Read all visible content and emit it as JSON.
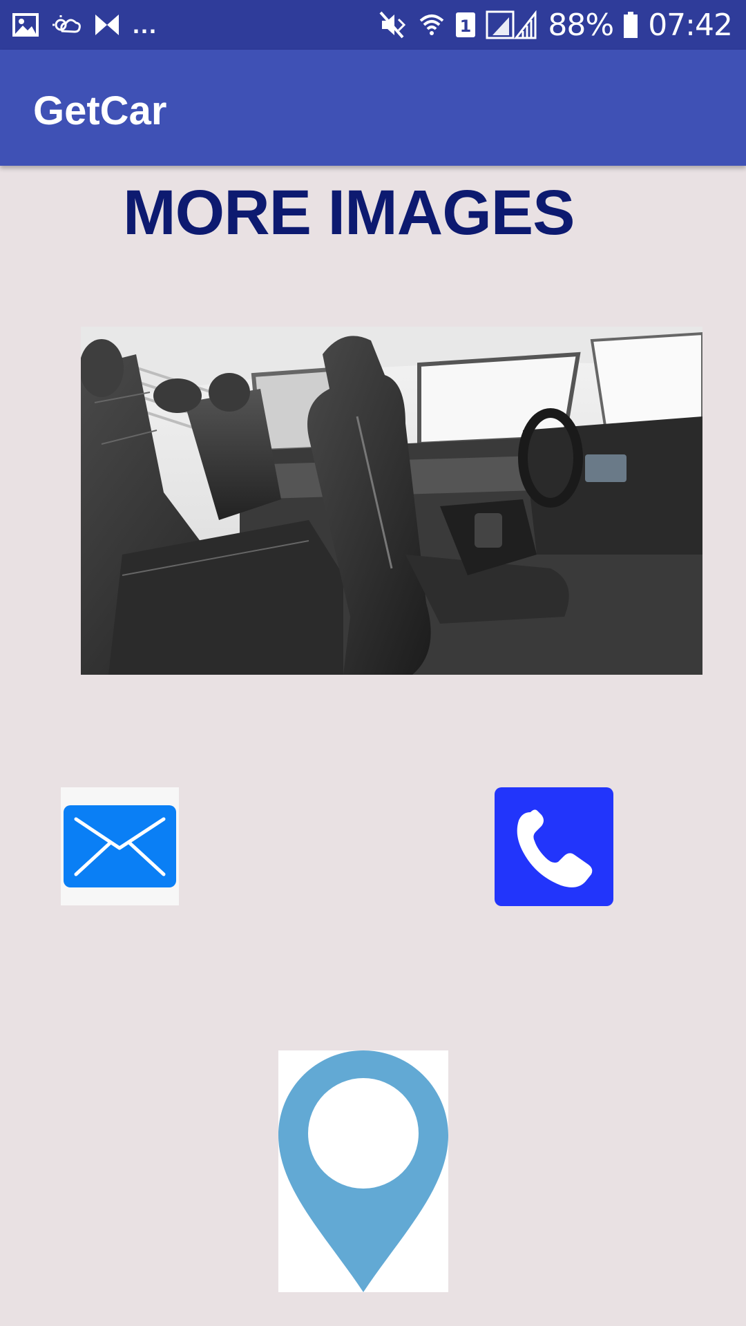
{
  "status_bar": {
    "battery": "88%",
    "time": "07:42",
    "sim_slot": "1",
    "overflow": "...",
    "icons": [
      "image-icon",
      "weather-icon",
      "app-icon",
      "mute-icon",
      "wifi-icon",
      "sim-icon",
      "signal-icon",
      "battery-icon"
    ]
  },
  "app_bar": {
    "title": "GetCar"
  },
  "main": {
    "heading": "MORE IMAGES",
    "image_alt": "car-interior-image"
  },
  "actions": {
    "email_icon": "email-icon",
    "phone_icon": "phone-icon",
    "location_icon": "location-pin-icon"
  },
  "colors": {
    "status_bar": "#2f3c9a",
    "app_bar": "#3f51b5",
    "background": "#e9e1e3",
    "heading": "#0d1a70",
    "email_blue": "#0a7ff5",
    "phone_blue": "#2235fb",
    "pin_blue": "#62a9d4"
  }
}
